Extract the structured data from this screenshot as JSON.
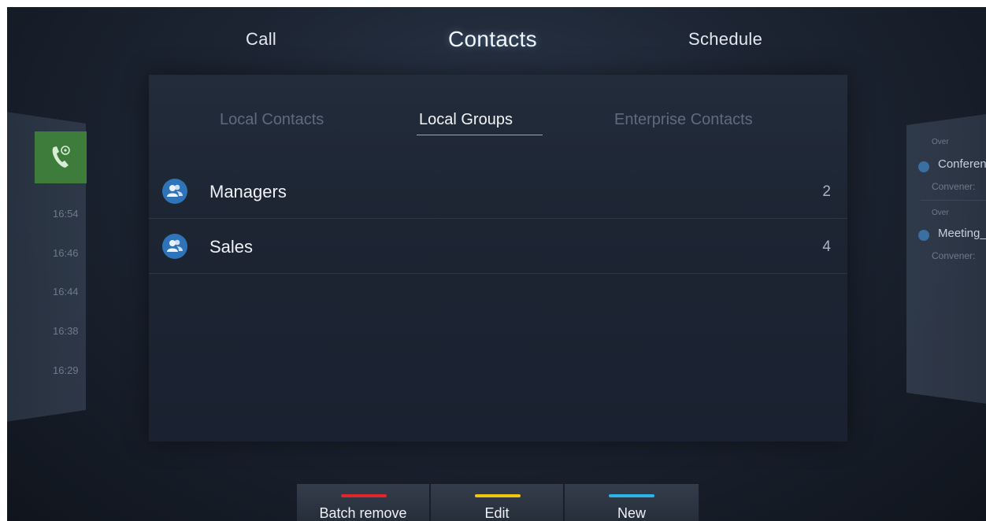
{
  "topnav": {
    "items": [
      "Call",
      "Contacts",
      "Schedule"
    ],
    "active": "Contacts"
  },
  "subtabs": {
    "items": [
      "Local Contacts",
      "Local Groups",
      "Enterprise Contacts"
    ],
    "active": "Local Groups"
  },
  "groups": [
    {
      "name": "Managers",
      "count": "2",
      "icon": "group-icon"
    },
    {
      "name": "Sales",
      "count": "4",
      "icon": "group-icon"
    }
  ],
  "left_panel": {
    "icon": "call-icon",
    "times": [
      "16:54",
      "16:46",
      "16:44",
      "16:38",
      "16:29"
    ]
  },
  "right_panel": {
    "items": [
      {
        "status": "Over",
        "title": "Conferenc",
        "convener": "Convener:"
      },
      {
        "status": "Over",
        "title": "Meeting_(",
        "convener": "Convener:"
      }
    ]
  },
  "softkeys": [
    {
      "label": "Batch remove",
      "color": "#e0262b"
    },
    {
      "label": "Edit",
      "color": "#f1c40f"
    },
    {
      "label": "New",
      "color": "#2ab4e8"
    }
  ],
  "colors": {
    "background": "#1c2432",
    "panel": "#1d2533",
    "group_icon": "#2f74b8",
    "call_icon": "#3d7c3b"
  }
}
